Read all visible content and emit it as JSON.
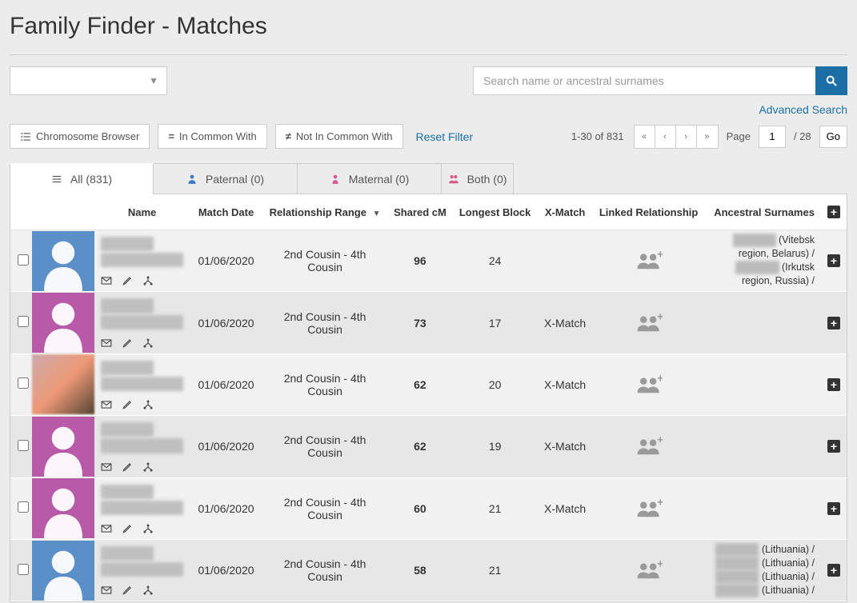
{
  "page_title": "Family Finder - Matches",
  "dropdown_caret": "▼",
  "search": {
    "placeholder": "Search name or ancestral surnames",
    "advanced_link": "Advanced Search"
  },
  "filter_buttons": {
    "chromosome": "Chromosome Browser",
    "in_common": "In Common With",
    "not_in_common": "Not In Common With",
    "reset": "Reset Filter"
  },
  "pager": {
    "range": "1-30 of 831",
    "page_label": "Page",
    "page_value": "1",
    "total_pages_label": "/ 28",
    "go_label": "Go"
  },
  "tabs": {
    "all": "All (831)",
    "paternal": "Paternal (0)",
    "maternal": "Maternal (0)",
    "both": "Both (0)"
  },
  "columns": {
    "name": "Name",
    "match_date": "Match Date",
    "relationship": "Relationship Range",
    "shared_cm": "Shared cM",
    "longest_block": "Longest Block",
    "x_match": "X-Match",
    "linked_relationship": "Linked Relationship",
    "ancestral_surnames": "Ancestral Surnames"
  },
  "matches": [
    {
      "avatar_type": "male",
      "match_date": "01/06/2020",
      "relationship": "2nd Cousin - 4th Cousin",
      "shared_cm": "96",
      "longest_block": "24",
      "x_match": "",
      "surnames_html": "████ (Vitebsk region, Belarus) / ████ (Irkutsk region, Russia) /"
    },
    {
      "avatar_type": "female",
      "match_date": "01/06/2020",
      "relationship": "2nd Cousin - 4th Cousin",
      "shared_cm": "73",
      "longest_block": "17",
      "x_match": "X-Match",
      "surnames_html": ""
    },
    {
      "avatar_type": "photo",
      "match_date": "01/06/2020",
      "relationship": "2nd Cousin - 4th Cousin",
      "shared_cm": "62",
      "longest_block": "20",
      "x_match": "X-Match",
      "surnames_html": ""
    },
    {
      "avatar_type": "female",
      "match_date": "01/06/2020",
      "relationship": "2nd Cousin - 4th Cousin",
      "shared_cm": "62",
      "longest_block": "19",
      "x_match": "X-Match",
      "surnames_html": ""
    },
    {
      "avatar_type": "female",
      "match_date": "01/06/2020",
      "relationship": "2nd Cousin - 4th Cousin",
      "shared_cm": "60",
      "longest_block": "21",
      "x_match": "X-Match",
      "surnames_html": ""
    },
    {
      "avatar_type": "male",
      "match_date": "01/06/2020",
      "relationship": "2nd Cousin - 4th Cousin",
      "shared_cm": "58",
      "longest_block": "21",
      "x_match": "",
      "surnames_html": "████ (Lithuania) / ████ (Lithuania) / ████ (Lithuania) / ████ (Lithuania) /"
    }
  ]
}
